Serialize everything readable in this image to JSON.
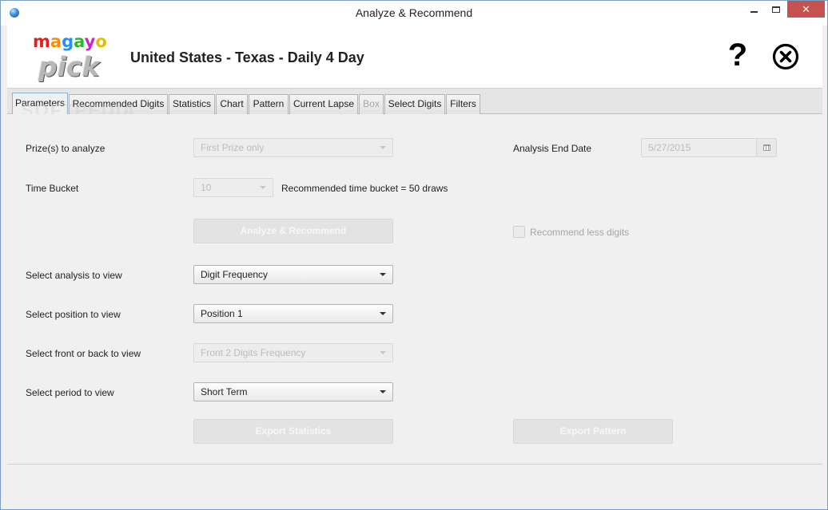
{
  "window": {
    "title": "Analyze & Recommend",
    "minimize": "",
    "maximize": "",
    "close": "✕"
  },
  "header": {
    "logo_top": "magayo",
    "logo_bottom": "pick",
    "title": "United States - Texas - Daily 4 Day",
    "help": "?"
  },
  "tabs": [
    {
      "label": "Parameters",
      "active": true
    },
    {
      "label": "Recommended Digits"
    },
    {
      "label": "Statistics"
    },
    {
      "label": "Chart"
    },
    {
      "label": "Pattern"
    },
    {
      "label": "Current Lapse"
    },
    {
      "label": "Box",
      "disabled": true
    },
    {
      "label": "Select Digits"
    },
    {
      "label": "Filters"
    }
  ],
  "watermark": "SOFTPEDIA",
  "form": {
    "prize_label": "Prize(s) to analyze",
    "prize_value": "First Prize only",
    "end_date_label": "Analysis End Date",
    "end_date_value": "5/27/2015",
    "bucket_label": "Time Bucket",
    "bucket_value": "10",
    "bucket_hint": "Recommended time bucket = 50 draws",
    "analyze_button": "Analyze & Recommend",
    "recommend_less_label": "Recommend less digits",
    "analysis_label": "Select analysis to view",
    "analysis_value": "Digit Frequency",
    "position_label": "Select position to view",
    "position_value": "Position 1",
    "front_back_label": "Select front or back to view",
    "front_back_value": "Front 2 Digits Frequency",
    "period_label": "Select period to view",
    "period_value": "Short Term",
    "export_statistics": "Export Statistics",
    "export_pattern": "Export Pattern"
  },
  "colors": {
    "close_button": "#c75050",
    "logo": [
      "#e02020",
      "#ff8c00",
      "#1e90ff",
      "#2eb82e",
      "#d020d0",
      "#e0c000"
    ]
  }
}
